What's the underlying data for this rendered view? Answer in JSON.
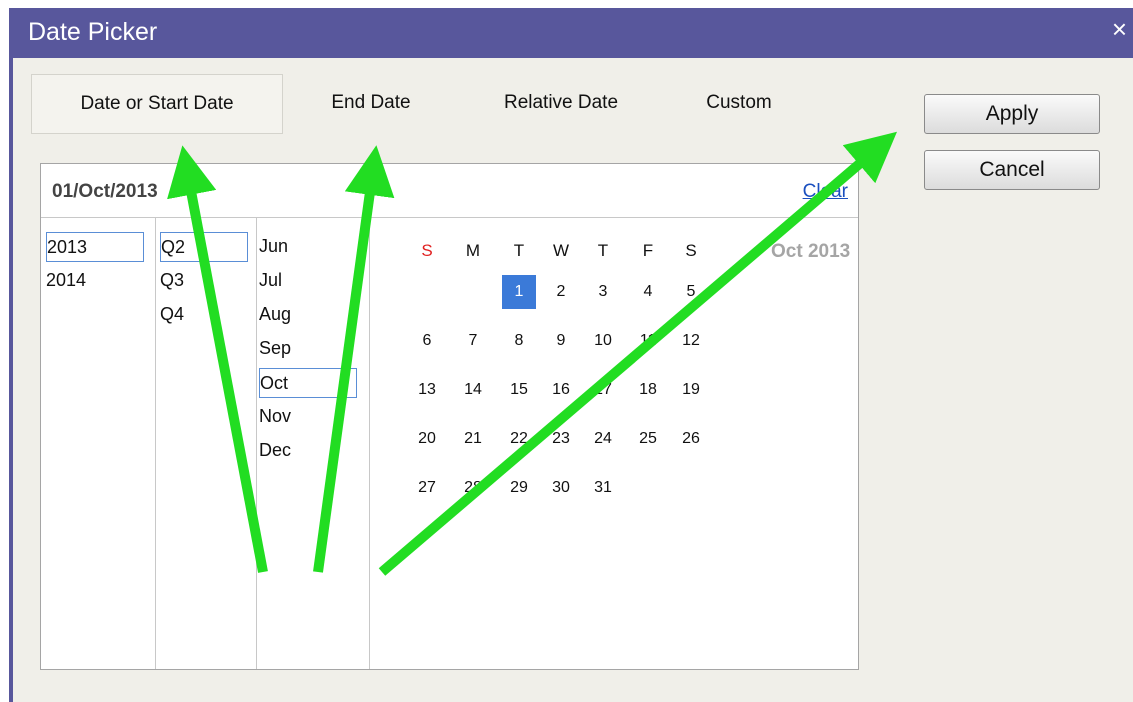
{
  "window": {
    "title": "Date Picker",
    "close_glyph": "×"
  },
  "tabs": [
    {
      "label": "Date or Start Date",
      "active": true
    },
    {
      "label": "End Date",
      "active": false
    },
    {
      "label": "Relative Date",
      "active": false
    },
    {
      "label": "Custom",
      "active": false
    }
  ],
  "buttons": {
    "apply": "Apply",
    "cancel": "Cancel"
  },
  "picker": {
    "date_display": "01/Oct/2013",
    "clear_label": "Clear",
    "years": [
      "2013",
      "2014"
    ],
    "selected_year": "2013",
    "quarters": [
      "Q2",
      "Q3",
      "Q4"
    ],
    "selected_quarter": "Q2",
    "months": [
      "Jun",
      "Jul",
      "Aug",
      "Sep",
      "Oct",
      "Nov",
      "Dec"
    ],
    "selected_month": "Oct",
    "calendar": {
      "month_label": "Oct 2013",
      "weekdays": [
        "S",
        "M",
        "T",
        "W",
        "T",
        "F",
        "S"
      ],
      "weeks": [
        [
          "",
          "",
          "1",
          "2",
          "3",
          "4",
          "5"
        ],
        [
          "6",
          "7",
          "8",
          "9",
          "10",
          "11",
          "12"
        ],
        [
          "13",
          "14",
          "15",
          "16",
          "17",
          "18",
          "19"
        ],
        [
          "20",
          "21",
          "22",
          "23",
          "24",
          "25",
          "26"
        ],
        [
          "27",
          "28",
          "29",
          "30",
          "31",
          "",
          ""
        ]
      ],
      "selected_day": "1"
    }
  },
  "colors": {
    "titlebar": "#58579c",
    "sunday": "#e02020",
    "selected_day": "#3b7ad8",
    "annotation_arrow": "#22dd22"
  }
}
